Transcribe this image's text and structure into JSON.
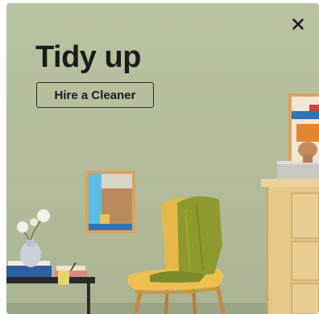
{
  "banner": {
    "title": "Tidy up",
    "cta_label": "Hire a Cleaner",
    "close_icon": "close-icon"
  },
  "colors": {
    "wall": "#b5bf9e",
    "title_text": "#1b1b1b",
    "chair": "#e8b94a",
    "throw": "#8f9a2e",
    "dresser": "#e6c88a"
  }
}
